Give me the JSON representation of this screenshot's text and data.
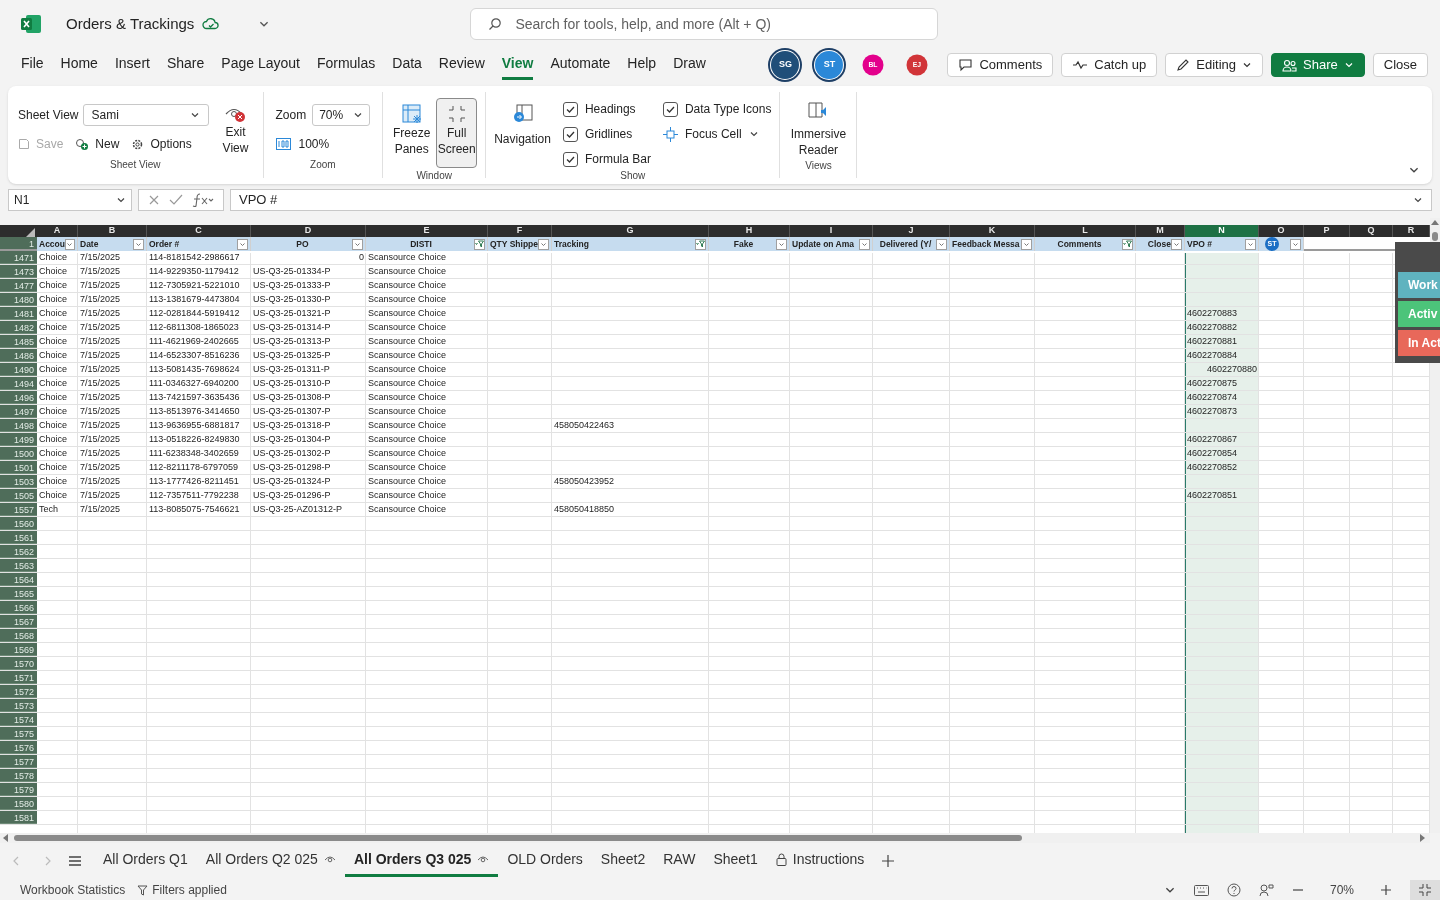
{
  "window": {
    "title": "Orders & Trackings",
    "search_placeholder": "Search for tools, help, and more (Alt + Q)"
  },
  "menu": [
    {
      "label": "File",
      "selected": false
    },
    {
      "label": "Home",
      "selected": false
    },
    {
      "label": "Insert",
      "selected": false
    },
    {
      "label": "Share",
      "selected": false
    },
    {
      "label": "Page Layout",
      "selected": false
    },
    {
      "label": "Formulas",
      "selected": false
    },
    {
      "label": "Data",
      "selected": false
    },
    {
      "label": "Review",
      "selected": false
    },
    {
      "label": "View",
      "selected": true
    },
    {
      "label": "Automate",
      "selected": false
    },
    {
      "label": "Help",
      "selected": false
    },
    {
      "label": "Draw",
      "selected": false
    }
  ],
  "collaborators": [
    {
      "initials": "SG",
      "color": "#1f4e79",
      "ring": true
    },
    {
      "initials": "ST",
      "color": "#2b88d8",
      "ring": true
    },
    {
      "initials": "BL",
      "color": "#e3008c",
      "ring": false
    },
    {
      "initials": "EJ",
      "color": "#d13438",
      "ring": false
    }
  ],
  "actions": [
    {
      "kind": "comments",
      "label": "Comments"
    },
    {
      "kind": "catchup",
      "label": "Catch up"
    },
    {
      "kind": "editing",
      "label": "Editing"
    },
    {
      "kind": "share",
      "label": "Share"
    },
    {
      "kind": "close",
      "label": "Close"
    }
  ],
  "ribbon": {
    "groups": [
      {
        "kind": "sheet_view",
        "label": "Sheet View",
        "field_label": "Sheet View",
        "field_value": "Sami",
        "items": [
          {
            "kind": "save",
            "label": "Save",
            "disabled": true
          },
          {
            "kind": "new",
            "label": "New",
            "disabled": false
          },
          {
            "kind": "options",
            "label": "Options",
            "disabled": false
          }
        ],
        "big": "Exit View"
      },
      {
        "kind": "zoom",
        "label": "Zoom",
        "field_label": "Zoom",
        "field_value": "70%",
        "item": "100%"
      },
      {
        "kind": "window",
        "label": "Window",
        "buttons": [
          {
            "kind": "freeze",
            "label": "Freeze Panes",
            "pressed": false
          },
          {
            "kind": "fullscreen",
            "label": "Full Screen",
            "pressed": true
          }
        ]
      },
      {
        "kind": "show",
        "label": "Show",
        "big": "Navigation",
        "checks": [
          {
            "label": "Headings",
            "checked": true
          },
          {
            "label": "Gridlines",
            "checked": true
          },
          {
            "label": "Formula Bar",
            "checked": true
          },
          {
            "label": "Data Type Icons",
            "checked": true
          }
        ],
        "focus": "Focus Cell"
      },
      {
        "kind": "views",
        "label": "Views",
        "big": "Immersive Reader"
      }
    ]
  },
  "formula_bar": {
    "name_box": "N1",
    "value": "VPO #"
  },
  "columns": [
    {
      "letter": "A",
      "label": "Accou",
      "filtered": false,
      "selected": false
    },
    {
      "letter": "B",
      "label": "Date",
      "filtered": false,
      "selected": false
    },
    {
      "letter": "C",
      "label": "Order #",
      "filtered": false,
      "selected": false
    },
    {
      "letter": "D",
      "label": "PO",
      "filtered": false,
      "selected": false
    },
    {
      "letter": "E",
      "label": "DISTI",
      "filtered": true,
      "selected": false
    },
    {
      "letter": "F",
      "label": "QTY Shippe",
      "filtered": false,
      "selected": false
    },
    {
      "letter": "G",
      "label": "Tracking",
      "filtered": true,
      "selected": false
    },
    {
      "letter": "H",
      "label": "Fake",
      "filtered": false,
      "selected": false
    },
    {
      "letter": "I",
      "label": "Update on Ama",
      "filtered": false,
      "selected": false
    },
    {
      "letter": "J",
      "label": "Delivered (Y/",
      "filtered": false,
      "selected": false
    },
    {
      "letter": "K",
      "label": "Feedback Messa",
      "filtered": false,
      "selected": false
    },
    {
      "letter": "L",
      "label": "Comments",
      "filtered": true,
      "selected": false
    },
    {
      "letter": "M",
      "label": "Close",
      "filtered": false,
      "selected": false
    },
    {
      "letter": "N",
      "label": "VPO #",
      "filtered": false,
      "selected": true
    },
    {
      "letter": "O",
      "avatar": "ST",
      "filtered": false,
      "selected": false
    },
    {
      "letter": "P",
      "selected": false
    },
    {
      "letter": "Q",
      "selected": false
    },
    {
      "letter": "R",
      "selected": false
    }
  ],
  "header_row": "1",
  "rows": [
    {
      "row": "1471",
      "A": "Choice",
      "B": "7/15/2025",
      "C": "114-8181542-2986617",
      "D": "0",
      "E": "Scansource Choice",
      "aligned_right": {
        "D": true
      }
    },
    {
      "row": "1473",
      "A": "Choice",
      "B": "7/15/2025",
      "C": "114-9229350-1179412",
      "D": "US-Q3-25-01334-P",
      "E": "Scansource Choice"
    },
    {
      "row": "1477",
      "A": "Choice",
      "B": "7/15/2025",
      "C": "112-7305921-5221010",
      "D": "US-Q3-25-01333-P",
      "E": "Scansource Choice"
    },
    {
      "row": "1480",
      "A": "Choice",
      "B": "7/15/2025",
      "C": "113-1381679-4473804",
      "D": "US-Q3-25-01330-P",
      "E": "Scansource Choice"
    },
    {
      "row": "1481",
      "A": "Choice",
      "B": "7/15/2025",
      "C": "112-0281844-5919412",
      "D": "US-Q3-25-01321-P",
      "E": "Scansource Choice",
      "N": "4602270883"
    },
    {
      "row": "1482",
      "A": "Choice",
      "B": "7/15/2025",
      "C": "112-6811308-1865023",
      "D": "US-Q3-25-01314-P",
      "E": "Scansource Choice",
      "N": "4602270882"
    },
    {
      "row": "1485",
      "A": "Choice",
      "B": "7/15/2025",
      "C": "111-4621969-2402665",
      "D": "US-Q3-25-01313-P",
      "E": "Scansource Choice",
      "N": "4602270881"
    },
    {
      "row": "1486",
      "A": "Choice",
      "B": "7/15/2025",
      "C": "114-6523307-8516236",
      "D": "US-Q3-25-01325-P",
      "E": "Scansource Choice",
      "N": "4602270884"
    },
    {
      "row": "1490",
      "A": "Choice",
      "B": "7/15/2025",
      "C": "113-5081435-7698624",
      "D": "US-Q3-25-01311-P",
      "E": "Scansource Choice",
      "N": "4602270880",
      "aligned_right": {
        "N": true
      }
    },
    {
      "row": "1494",
      "A": "Choice",
      "B": "7/15/2025",
      "C": "111-0346327-6940200",
      "D": "US-Q3-25-01310-P",
      "E": "Scansource Choice",
      "N": "4602270875"
    },
    {
      "row": "1496",
      "A": "Choice",
      "B": "7/15/2025",
      "C": "113-7421597-3635436",
      "D": "US-Q3-25-01308-P",
      "E": "Scansource Choice",
      "N": "4602270874"
    },
    {
      "row": "1497",
      "A": "Choice",
      "B": "7/15/2025",
      "C": "113-8513976-3414650",
      "D": "US-Q3-25-01307-P",
      "E": "Scansource Choice",
      "N": "4602270873"
    },
    {
      "row": "1498",
      "A": "Choice",
      "B": "7/15/2025",
      "C": "113-9636955-6881817",
      "D": "US-Q3-25-01318-P",
      "E": "Scansource Choice",
      "G": "458050422463"
    },
    {
      "row": "1499",
      "A": "Choice",
      "B": "7/15/2025",
      "C": "113-0518226-8249830",
      "D": "US-Q3-25-01304-P",
      "E": "Scansource Choice",
      "N": "4602270867"
    },
    {
      "row": "1500",
      "A": "Choice",
      "B": "7/15/2025",
      "C": "111-6238348-3402659",
      "D": "US-Q3-25-01302-P",
      "E": "Scansource Choice",
      "N": "4602270854"
    },
    {
      "row": "1501",
      "A": "Choice",
      "B": "7/15/2025",
      "C": "112-8211178-6797059",
      "D": "US-Q3-25-01298-P",
      "E": "Scansource Choice",
      "N": "4602270852"
    },
    {
      "row": "1503",
      "A": "Choice",
      "B": "7/15/2025",
      "C": "113-1777426-8211451",
      "D": "US-Q3-25-01324-P",
      "E": "Scansource Choice",
      "G": "458050423952"
    },
    {
      "row": "1505",
      "A": "Choice",
      "B": "7/15/2025",
      "C": "112-7357511-7792238",
      "D": "US-Q3-25-01296-P",
      "E": "Scansource Choice",
      "N": "4602270851"
    },
    {
      "row": "1557",
      "A": "Tech",
      "B": "7/15/2025",
      "C": "113-8085075-7546621",
      "D": "US-Q3-25-AZ01312-P",
      "E": "Scansource Choice",
      "G": "458050418850"
    },
    {
      "row": "1560"
    },
    {
      "row": "1561"
    },
    {
      "row": "1562"
    },
    {
      "row": "1563"
    },
    {
      "row": "1564"
    },
    {
      "row": "1565"
    },
    {
      "row": "1566"
    },
    {
      "row": "1567"
    },
    {
      "row": "1568"
    },
    {
      "row": "1569"
    },
    {
      "row": "1570"
    },
    {
      "row": "1571"
    },
    {
      "row": "1572"
    },
    {
      "row": "1573"
    },
    {
      "row": "1574"
    },
    {
      "row": "1575"
    },
    {
      "row": "1576"
    },
    {
      "row": "1577"
    },
    {
      "row": "1578"
    },
    {
      "row": "1579"
    },
    {
      "row": "1580"
    },
    {
      "row": "1581"
    }
  ],
  "panel_buttons": [
    {
      "label": "Work",
      "color": "#5fb3bf"
    },
    {
      "label": "Activ",
      "color": "#4cc47a"
    },
    {
      "label": "In Act",
      "color": "#e8685a"
    }
  ],
  "sheet_tabs": [
    {
      "label": "All Orders Q1",
      "selected": false,
      "kind": "plain"
    },
    {
      "label": "All Orders Q2 025",
      "selected": false,
      "kind": "watched"
    },
    {
      "label": "All Orders Q3 025",
      "selected": true,
      "kind": "watched"
    },
    {
      "label": "OLD Orders",
      "selected": false,
      "kind": "plain"
    },
    {
      "label": "Sheet2",
      "selected": false,
      "kind": "plain"
    },
    {
      "label": "RAW",
      "selected": false,
      "kind": "plain"
    },
    {
      "label": "Sheet1",
      "selected": false,
      "kind": "plain"
    },
    {
      "label": "Instructions",
      "selected": false,
      "kind": "locked"
    }
  ],
  "status_bar": {
    "left": [
      "Workbook Statistics",
      "Filters applied"
    ],
    "zoom": "70%"
  }
}
